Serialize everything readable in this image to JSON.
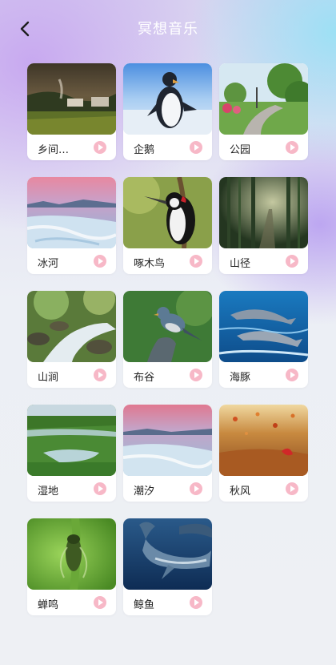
{
  "header": {
    "title": "冥想音乐",
    "back_icon": "chevron-left-icon"
  },
  "accent": {
    "play": "#f7b8c7",
    "title": "#ffffff"
  },
  "items": [
    {
      "label": "乡间…",
      "scene": "countryside"
    },
    {
      "label": "企鹅",
      "scene": "penguin"
    },
    {
      "label": "公园",
      "scene": "park"
    },
    {
      "label": "冰河",
      "scene": "glacier"
    },
    {
      "label": "啄木鸟",
      "scene": "woodpecker"
    },
    {
      "label": "山径",
      "scene": "bamboo-path"
    },
    {
      "label": "山涧",
      "scene": "stream"
    },
    {
      "label": "布谷",
      "scene": "cuckoo"
    },
    {
      "label": "海豚",
      "scene": "dolphin"
    },
    {
      "label": "湿地",
      "scene": "wetland"
    },
    {
      "label": "潮汐",
      "scene": "tide"
    },
    {
      "label": "秋风",
      "scene": "autumn"
    },
    {
      "label": "蝉鸣",
      "scene": "cicada"
    },
    {
      "label": "鲸鱼",
      "scene": "whale"
    }
  ]
}
